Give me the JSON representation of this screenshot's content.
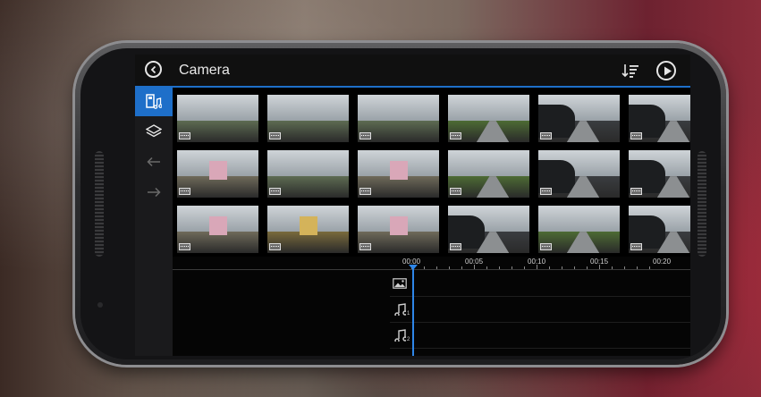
{
  "app": {
    "title": "Camera"
  },
  "toolbar": {
    "back_icon": "chevron-left-icon",
    "sort_icon": "sort-icon",
    "play_icon": "play-icon"
  },
  "sidebar": {
    "items": [
      {
        "icon": "media-icon",
        "active": true
      },
      {
        "icon": "layers-icon",
        "active": false
      },
      {
        "icon": "undo-icon",
        "active": false
      },
      {
        "icon": "redo-icon",
        "active": false
      }
    ]
  },
  "media_grid": {
    "rows": [
      [
        "plaza-fountain",
        "plaza-trees",
        "plaza-palms",
        "road-grass",
        "car-road",
        "car-road-2"
      ],
      [
        "church-pink",
        "plaza-wide",
        "church-trees",
        "road-grass-2",
        "car-road-3",
        "car-road-4"
      ],
      [
        "church-street",
        "building-yellow",
        "church-cloudy",
        "car-grass",
        "road-long",
        "car-road-5"
      ]
    ]
  },
  "timeline": {
    "ticks": [
      "00:00",
      "00:05",
      "00:10",
      "00:15",
      "00:20"
    ],
    "tracks": [
      {
        "icon": "image-track-icon",
        "sub": ""
      },
      {
        "icon": "music-track-icon",
        "sub": "1"
      },
      {
        "icon": "music-track-icon",
        "sub": "2"
      }
    ]
  },
  "colors": {
    "accent": "#1e6fc9",
    "playhead": "#2e86e8"
  }
}
